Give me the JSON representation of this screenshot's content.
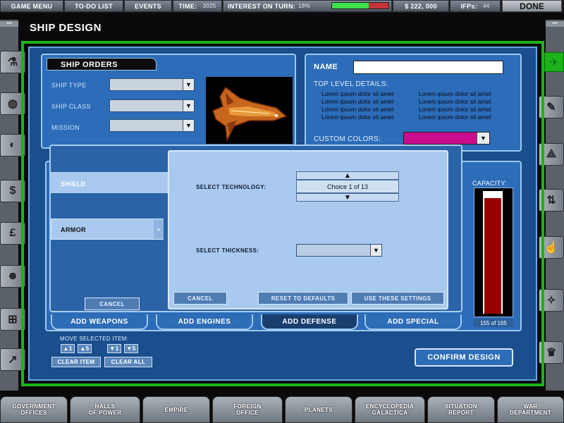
{
  "topbar": {
    "game_menu": "GAME MENU",
    "todo": "TO-DO LIST",
    "events": "EVENTS",
    "time_label": "TIME:",
    "time_value": "3025",
    "interest_label": "INTEREST ON TURN:",
    "interest_value": "18%",
    "interest_fraction": 0.65,
    "money": "$ 222, 000",
    "ifps_label": "IFPs:",
    "ifps_value": "44",
    "done": "DONE"
  },
  "page_title": "SHIP DESIGN",
  "ship_orders": {
    "header": "SHIP ORDERS",
    "ship_type": "SHIP TYPE",
    "ship_class": "SHIP CLASS",
    "mission": "MISSION"
  },
  "name_panel": {
    "name_label": "NAME",
    "name_value": "",
    "details_header": "TOP LEVEL DETAILS:",
    "details_col1": [
      "Lorem ipsum dolor sit amet",
      "Lorem ipsum dolor sit amet",
      "Lorem ipsum dolor sit amet",
      "Lorem ipsum dolor sit amet"
    ],
    "details_col2": [
      "Lorem ipsum dolor sit amet",
      "Lorem ipsum dolor sit amet",
      "Lorem ipsum dolor sit amet",
      "Lorem ipsum dolor sit amet"
    ],
    "custom_colors": "CUSTOM COLORS:",
    "custom_color_value": "#cc0c8e"
  },
  "capacity": {
    "label": "CAPACITY:",
    "value": "155 of 165",
    "fraction": 0.94
  },
  "tabs": {
    "weapons": "ADD WEAPONS",
    "engines": "ADD ENGINES",
    "defense": "ADD DEFENSE",
    "special": "ADD SPECIAL"
  },
  "move_item": {
    "label": "MOVE SELECTED ITEM:",
    "up1": "▲1",
    "up5": "▲5",
    "down1": "▼1",
    "down5": "▼5",
    "clear_item": "CLEAR ITEM",
    "clear_all": "CLEAR ALL"
  },
  "confirm": "CONFIRM DESIGN",
  "dialog": {
    "shield": "SHIELD",
    "armor": "ARMOR",
    "select_technology": "SELECT TECHNOLOGY:",
    "choice": "Choice 1 of 13",
    "select_thickness": "SELECT THICKNESS:",
    "cancel_left": "CANCEL",
    "cancel": "CANCEL",
    "reset": "RESET TO DEFAULTS",
    "use": "USE THESE SETTINGS"
  },
  "bottom_nav": [
    {
      "l1": "GOVERNMENT",
      "l2": "OFFICES"
    },
    {
      "l1": "HALLS",
      "l2": "OF POWER"
    },
    {
      "l1": "EMPIRE",
      "l2": ""
    },
    {
      "l1": "FOREIGN",
      "l2": "OFFICE"
    },
    {
      "l1": "PLANETS",
      "l2": ""
    },
    {
      "l1": "ENCYCLOPEDIA",
      "l2": "GALACTICA"
    },
    {
      "l1": "SITUATION",
      "l2": "REPORT"
    },
    {
      "l1": "WAR",
      "l2": "DEPARTMENT"
    }
  ],
  "left_icons": [
    "flask-icon",
    "globe-icon",
    "planet-icon",
    "dollar-icon",
    "pound-icon",
    "people-icon",
    "org-chart-icon",
    "graph-icon"
  ],
  "right_icons": [
    "rocket-icon",
    "wrench-icon",
    "fighter-icon",
    "arrows-icon",
    "thumbs-up-icon",
    "starship-icon",
    "trophy-icon"
  ],
  "colors": {
    "accent_green": "#1db21a",
    "panel_blue": "#2c6cb8",
    "capacity_red": "#990000"
  }
}
